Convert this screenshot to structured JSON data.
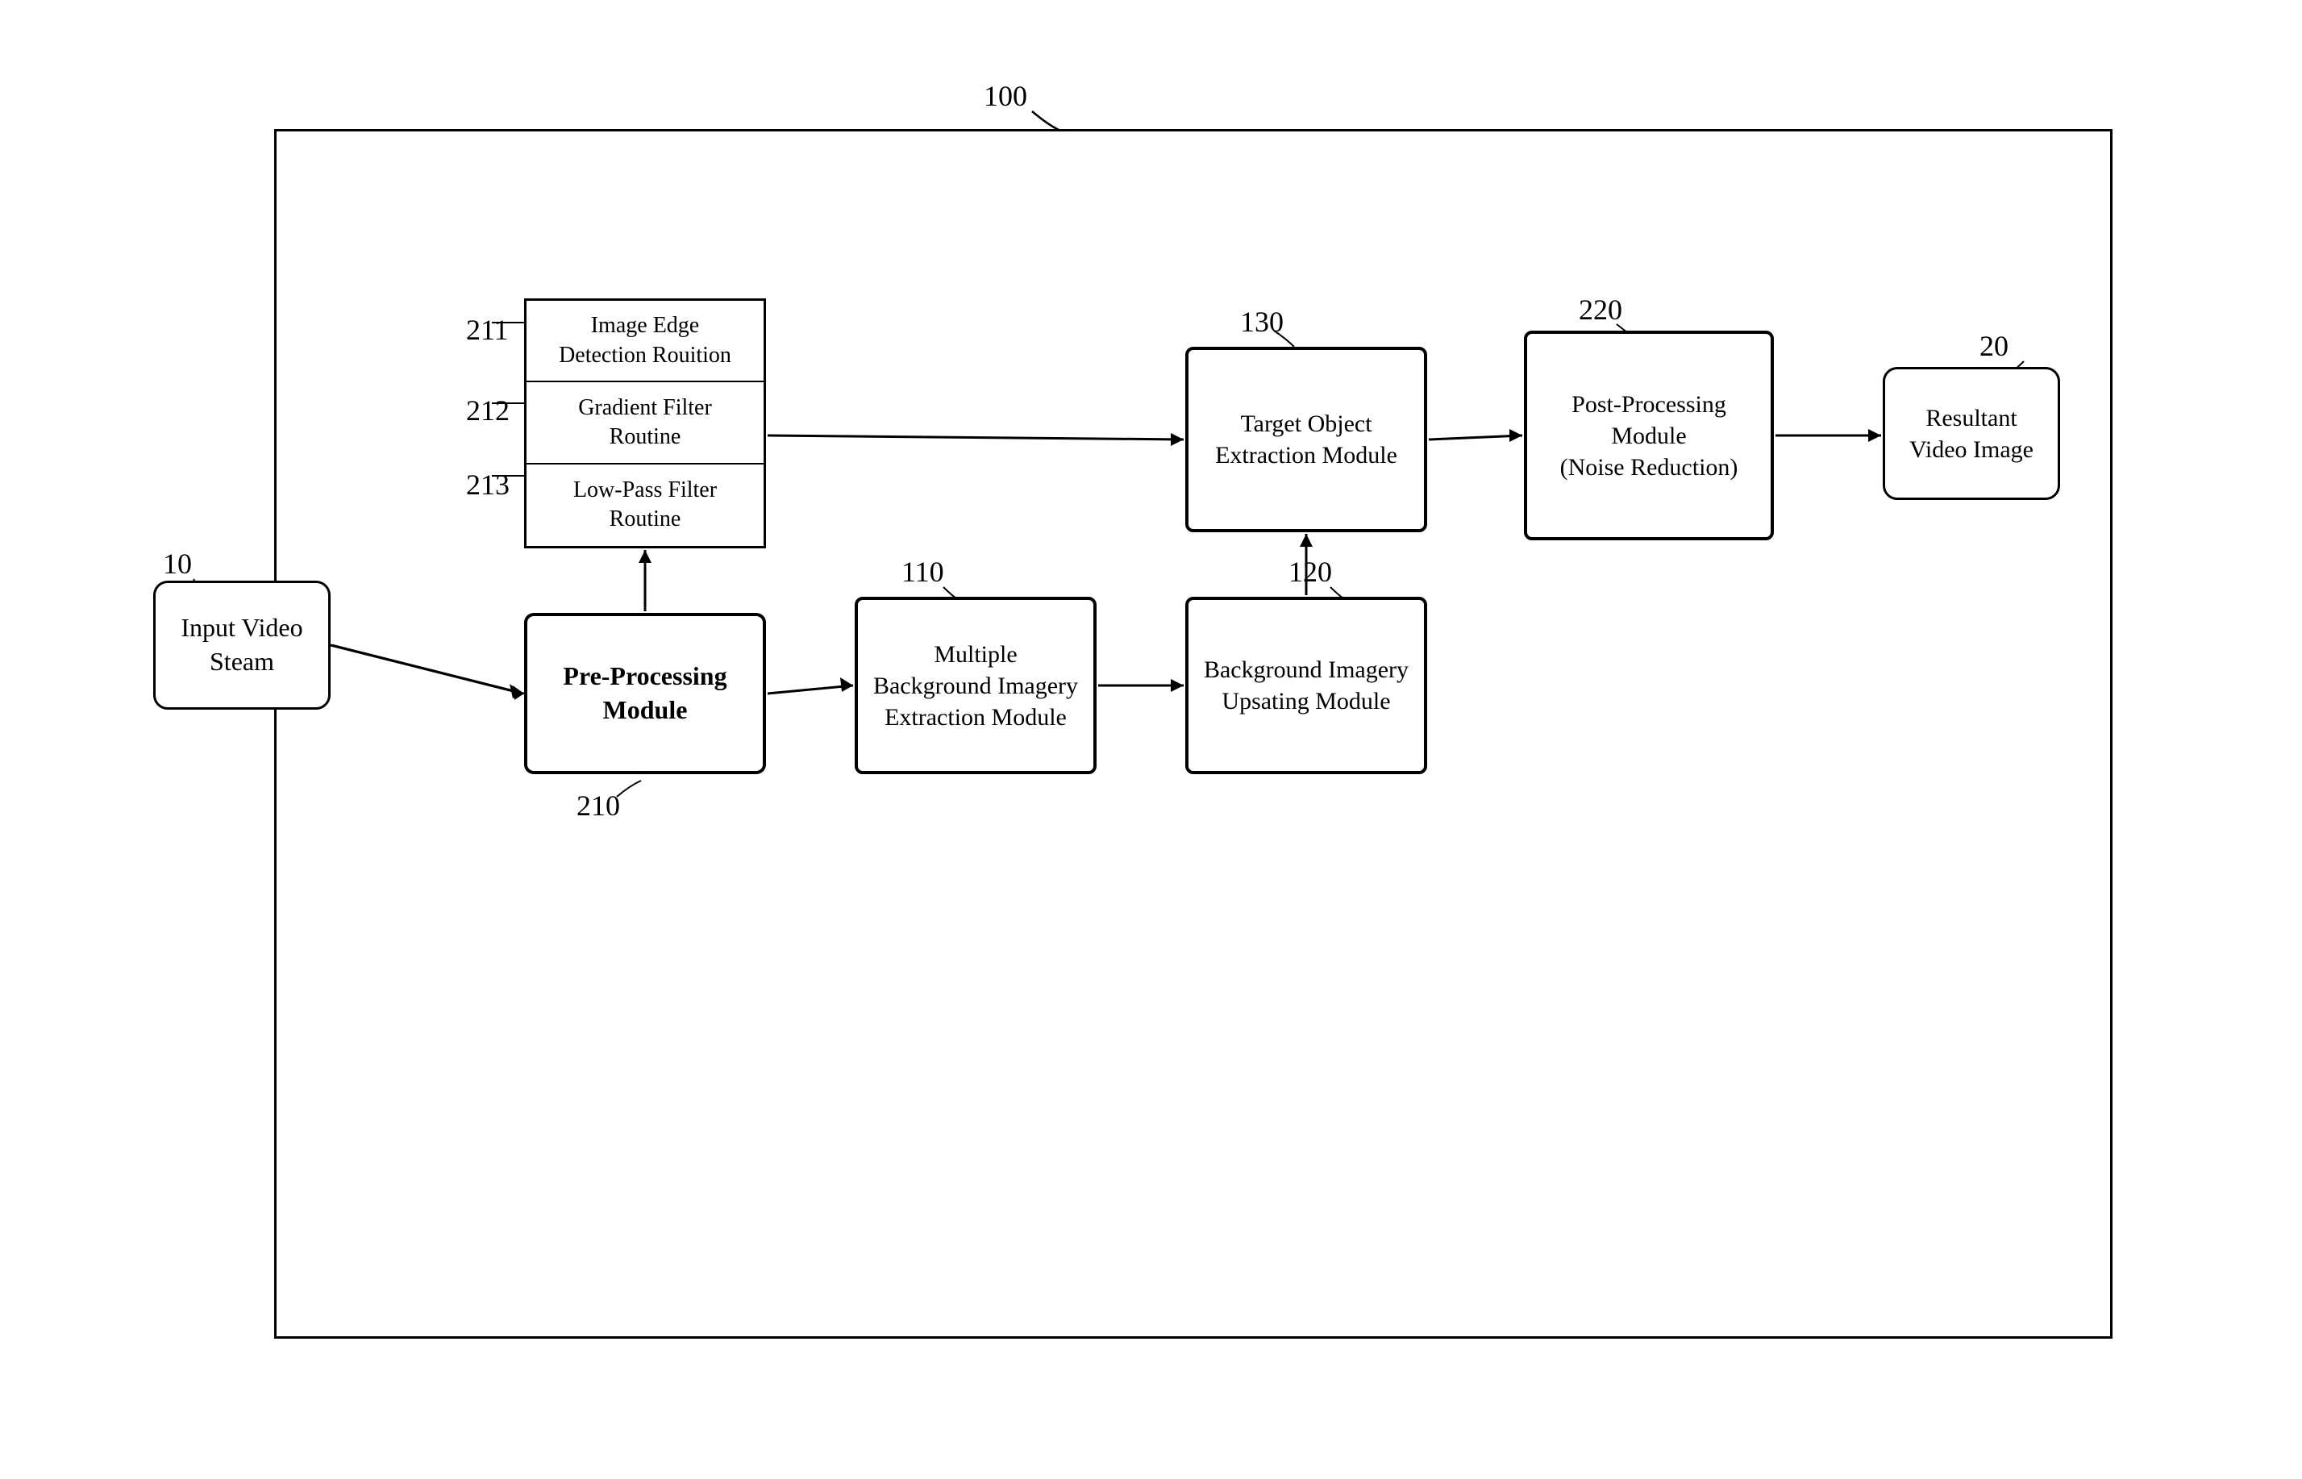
{
  "diagram": {
    "label_100": "100",
    "label_10": "10",
    "label_20": "20",
    "label_110": "110",
    "label_120": "120",
    "label_130": "130",
    "label_210": "210",
    "label_211": "211",
    "label_212": "212",
    "label_213": "213",
    "label_220": "220",
    "box_input_video": "Input Video\nSteam",
    "box_input_video_line1": "Input Video",
    "box_input_video_line2": "Steam",
    "box_preprocessing_line1": "Pre-Processing",
    "box_preprocessing_line2": "Module",
    "routine_211": "Image Edge\nDetection Rouition",
    "routine_211_line1": "Image Edge",
    "routine_211_line2": "Detection Rouition",
    "routine_212_line1": "Gradient Filter",
    "routine_212_line2": "Routine",
    "routine_213_line1": "Low-Pass Filter",
    "routine_213_line2": "Routine",
    "box_multi_bg_line1": "Multiple",
    "box_multi_bg_line2": "Background Imagery",
    "box_multi_bg_line3": "Extraction Module",
    "box_bg_update_line1": "Background Imagery",
    "box_bg_update_line2": "Upsating Module",
    "box_target_line1": "Target Object",
    "box_target_line2": "Extraction Module",
    "box_postprocess_line1": "Post-Processing",
    "box_postprocess_line2": "Module",
    "box_postprocess_line3": "(Noise Reduction)",
    "box_result_line1": "Resultant",
    "box_result_line2": "Video Image"
  }
}
